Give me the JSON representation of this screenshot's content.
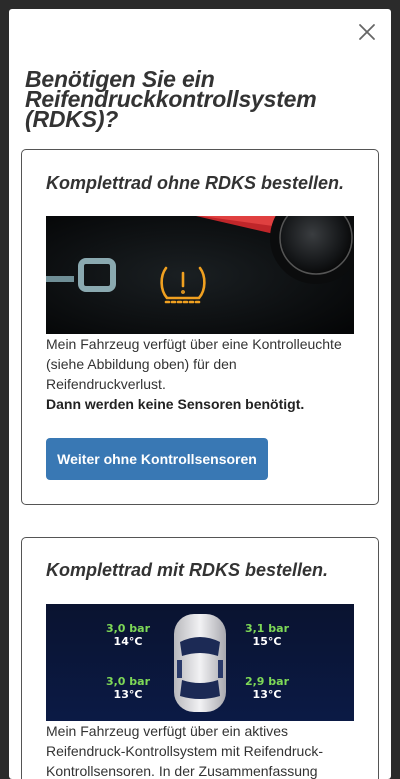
{
  "modal": {
    "close_icon": "close-icon",
    "title": "Benötigen Sie ein Reifendruckkontrollsystem (RDKS)?"
  },
  "option_without": {
    "title": "Komplettrad ohne RDKS bestellen.",
    "description": "Mein Fahrzeug verfügt über eine Kontrolleuchte (siehe Abbildung oben) für den Reifendruckverlust.",
    "description_bold": "Dann werden keine Sensoren benötigt.",
    "button_label": "Weiter ohne Kontrollsensoren",
    "image": "tpms-warning-light-dashboard"
  },
  "option_with": {
    "title": "Komplettrad mit RDKS bestellen.",
    "description": "Mein Fahrzeug verfügt über ein aktives Reifendruck-Kontrollsystem mit Reifendruck-Kontrollsensoren. In der Zusammenfassung",
    "image": "tpms-car-display",
    "tires": {
      "front_left": {
        "pressure": "3,0 bar",
        "temp": "14°C"
      },
      "front_right": {
        "pressure": "3,1 bar",
        "temp": "15°C"
      },
      "rear_left": {
        "pressure": "3,0 bar",
        "temp": "13°C"
      },
      "rear_right": {
        "pressure": "2,9 bar",
        "temp": "13°C"
      }
    }
  },
  "colors": {
    "button": "#3978b4",
    "warning_amber": "#f0a020",
    "display_green": "#7ed957"
  }
}
